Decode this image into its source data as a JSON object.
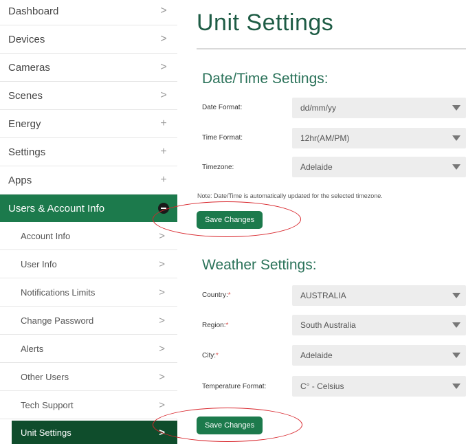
{
  "sidebar": {
    "items": [
      {
        "label": "Dashboard",
        "indicator": ">"
      },
      {
        "label": "Devices",
        "indicator": ">"
      },
      {
        "label": "Cameras",
        "indicator": ">"
      },
      {
        "label": "Scenes",
        "indicator": ">"
      },
      {
        "label": "Energy",
        "indicator": "+"
      },
      {
        "label": "Settings",
        "indicator": "+"
      },
      {
        "label": "Apps",
        "indicator": "+"
      },
      {
        "label": "Users & Account Info",
        "indicator": "−"
      }
    ],
    "subitems": [
      {
        "label": "Account Info",
        "indicator": ">"
      },
      {
        "label": "User Info",
        "indicator": ">"
      },
      {
        "label": "Notifications Limits",
        "indicator": ">"
      },
      {
        "label": "Change Password",
        "indicator": ">"
      },
      {
        "label": "Alerts",
        "indicator": ">"
      },
      {
        "label": "Other Users",
        "indicator": ">"
      },
      {
        "label": "Tech Support",
        "indicator": ">"
      },
      {
        "label": "Unit Settings",
        "indicator": ">"
      }
    ]
  },
  "main": {
    "title": "Unit Settings",
    "datetime": {
      "heading": "Date/Time Settings:",
      "fields": [
        {
          "label": "Date Format:",
          "value": "dd/mm/yy"
        },
        {
          "label": "Time Format:",
          "value": "12hr(AM/PM)"
        },
        {
          "label": "Timezone:",
          "value": "Adelaide"
        }
      ],
      "note": "Note: Date/Time is automatically updated for the selected timezone.",
      "save_label": "Save Changes"
    },
    "weather": {
      "heading": "Weather Settings:",
      "fields": [
        {
          "label": "Country:",
          "required": "*",
          "value": "AUSTRALIA"
        },
        {
          "label": "Region:",
          "required": "*",
          "value": "South Australia"
        },
        {
          "label": "City:",
          "required": "*",
          "value": "Adelaide"
        },
        {
          "label": "Temperature Format:",
          "required": "",
          "value": "C° - Celsius"
        }
      ],
      "save_label": "Save Changes"
    }
  },
  "colors": {
    "accent": "#1c7a4c",
    "active_item": "#0f4d2c",
    "annotation": "#d8252b"
  }
}
